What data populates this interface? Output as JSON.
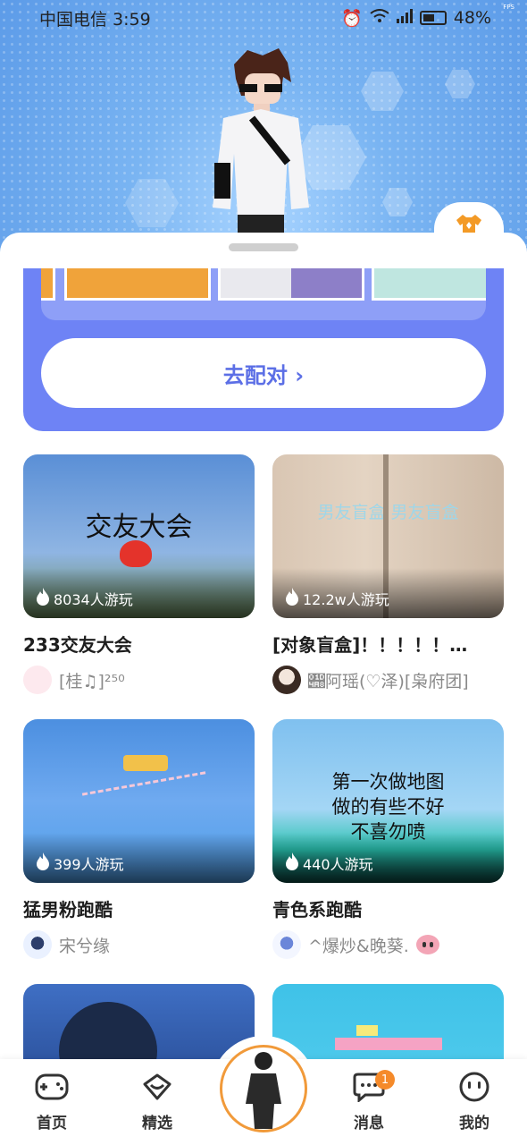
{
  "status_bar": {
    "carrier_time": "中国电信 3:59",
    "battery": "48%",
    "fps": "FPS"
  },
  "match_section": {
    "button_label": "去配对 ›"
  },
  "games": [
    {
      "title": "233交友大会",
      "plays": "8034人游玩",
      "author": "[桂♫]²⁵⁰",
      "image_text": "交友大会"
    },
    {
      "title": "[对象盲盒]！！！！！…",
      "plays": "12.2w人游玩",
      "author": "𝒨阿瑶(♡泽)[枭府团]",
      "image_text": "男友盲盒   男友盲盒"
    },
    {
      "title": "猛男粉跑酷",
      "plays": "399人游玩",
      "author": "宋兮缘",
      "image_text": ""
    },
    {
      "title": "青色系跑酷",
      "plays": "440人游玩",
      "author": "^爆炒&晚葵.",
      "image_text": "第一次做地图\n做的有些不好\n不喜勿喷"
    }
  ],
  "tabbar": {
    "items": [
      {
        "label": "首页",
        "icon": "gamepad-icon"
      },
      {
        "label": "精选",
        "icon": "heart-chat-icon"
      },
      {
        "label": "消息",
        "icon": "message-icon",
        "badge": "1"
      },
      {
        "label": "我的",
        "icon": "smiley-icon"
      }
    ]
  },
  "colors": {
    "accent_purple": "#6e83f5",
    "accent_orange": "#f19a3a",
    "sky": "#79b4f2"
  }
}
